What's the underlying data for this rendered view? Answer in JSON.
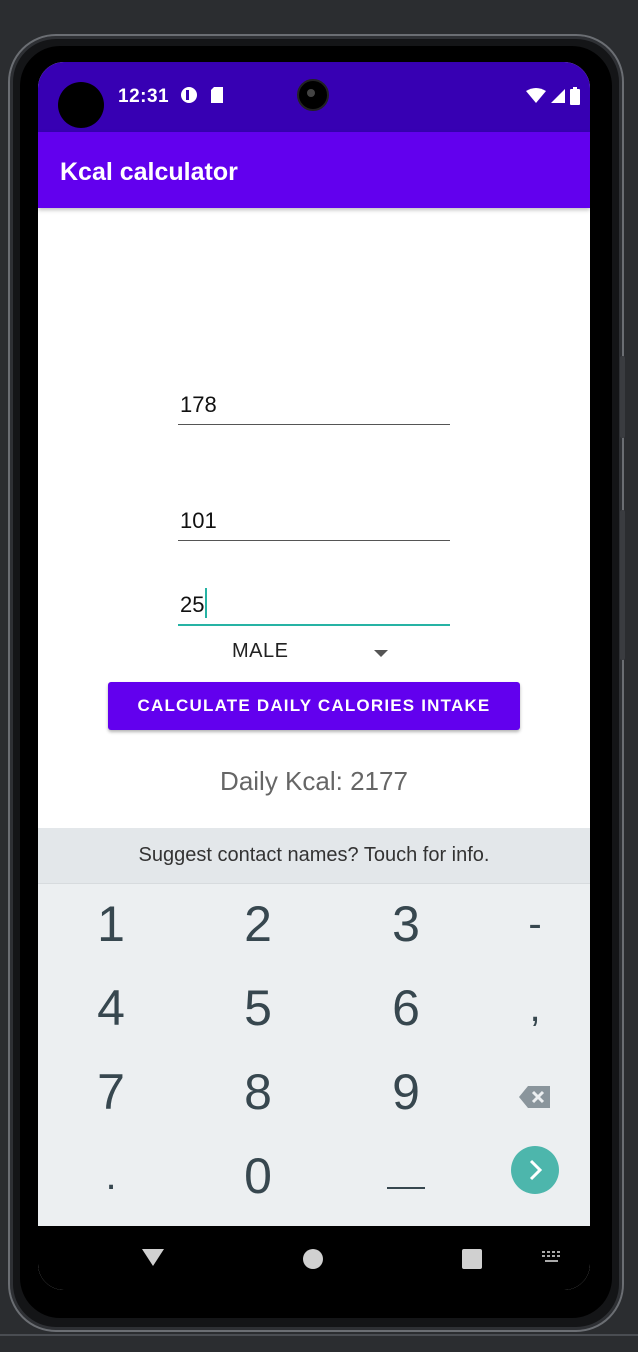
{
  "status_bar": {
    "time": "12:31",
    "icons": [
      "media-icon",
      "sdcard-icon",
      "wifi-icon",
      "signal-icon",
      "battery-icon"
    ]
  },
  "app_bar": {
    "title": "Kcal calculator"
  },
  "form": {
    "height_value": "178",
    "weight_value": "101",
    "age_value": "25",
    "gender_selected": "MALE",
    "calculate_label": "CALCULATE DAILY CALORIES INTAKE",
    "result_text": "Daily Kcal: 2177"
  },
  "keyboard": {
    "suggestion": "Suggest contact names? Touch for info.",
    "keys": {
      "k1": "1",
      "k2": "2",
      "k3": "3",
      "kminus": "-",
      "k4": "4",
      "k5": "5",
      "k6": "6",
      "kcomma": ",",
      "k7": "7",
      "k8": "8",
      "k9": "9",
      "kdot": ".",
      "k0": "0"
    }
  },
  "colors": {
    "status_bar": "#3700b3",
    "primary": "#6200ee",
    "accent": "#26b3a4"
  }
}
